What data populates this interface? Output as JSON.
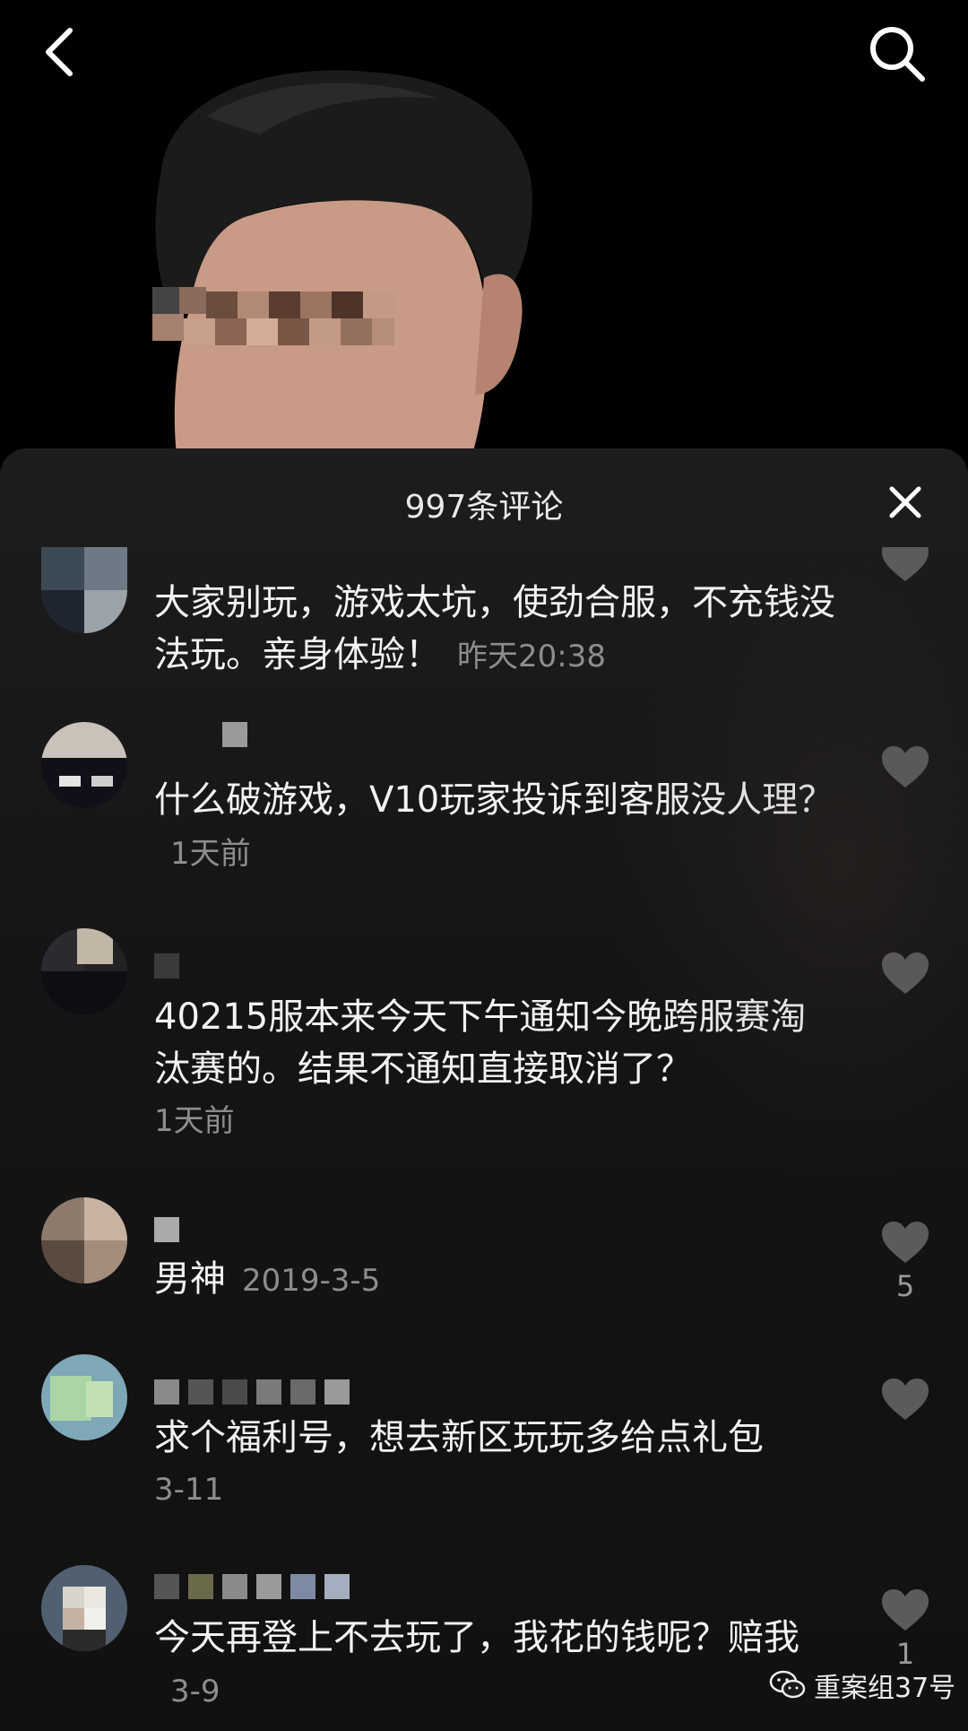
{
  "header": {
    "comment_count_title": "997条评论"
  },
  "comments": [
    {
      "text": "大家别玩，游戏太坑，使劲合服，不充钱没法玩。亲身体验！",
      "time": "昨天20:38",
      "likes": ""
    },
    {
      "text": "什么破游戏，V10玩家投诉到客服没人理？",
      "time": "1天前",
      "likes": ""
    },
    {
      "text": "40215服本来今天下午通知今晚跨服赛淘汰赛的。结果不通知直接取消了？",
      "time": "1天前",
      "likes": ""
    },
    {
      "text": "男神",
      "time": "2019-3-5",
      "likes": "5"
    },
    {
      "text": "求个福利号，想去新区玩玩多给点礼包",
      "time": "3-11",
      "likes": ""
    },
    {
      "text": "今天再登上不去玩了，我花的钱呢？赔我",
      "time": "3-9",
      "likes": "1"
    }
  ],
  "watermark": {
    "text": "重案组37号",
    "icon": "wechat-icon"
  },
  "icons": {
    "back": "back-icon",
    "search": "search-icon",
    "close": "close-icon",
    "like": "heart-icon"
  },
  "colors": {
    "background": "#000000",
    "sheet": "#1a1a1a",
    "text": "#f2f2f2",
    "muted": "#8d8d8d"
  }
}
